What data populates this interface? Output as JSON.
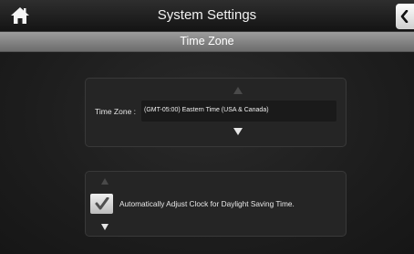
{
  "header": {
    "title": "System Settings",
    "home_icon": "home-icon",
    "back_icon": "chevron-left-icon"
  },
  "section": {
    "title": "Time Zone"
  },
  "time_zone": {
    "label": "Time Zone :",
    "value": "(GMT-05:00) Eastern Time (USA & Canada)",
    "up_icon": "arrow-up-icon",
    "down_icon": "arrow-down-icon"
  },
  "daylight_saving": {
    "label": "Automatically Adjust Clock for Daylight Saving Time.",
    "checked": true,
    "up_icon": "arrow-up-icon",
    "down_icon": "arrow-down-icon"
  },
  "colors": {
    "background": "#1c1c1c",
    "panel": "#252525",
    "section_header": "#8a8a8a",
    "text": "#f2f2f2"
  }
}
